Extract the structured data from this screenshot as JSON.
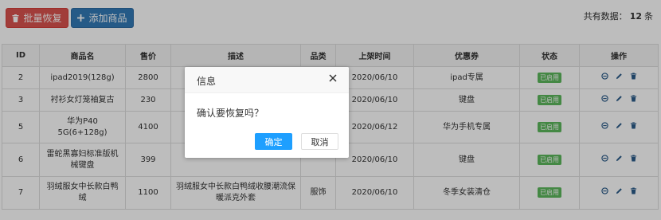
{
  "toolbar": {
    "batch_restore_label": "批量恢复",
    "add_product_label": "添加商品",
    "count_prefix": "共有数据：",
    "count_value": "12",
    "count_suffix": "条"
  },
  "table": {
    "headers": [
      "ID",
      "商品名",
      "售价",
      "描述",
      "品类",
      "上架时间",
      "优惠券",
      "状态",
      "操作"
    ],
    "rows": [
      {
        "id": "2",
        "name": "ipad2019(128g)",
        "price": "2800",
        "desc": "",
        "category": "",
        "date": "2020/06/10",
        "coupon": "ipad专属",
        "status": "已启用"
      },
      {
        "id": "3",
        "name": "衬衫女灯笼袖复古",
        "price": "230",
        "desc": "",
        "category": "",
        "date": "2020/06/10",
        "coupon": "键盘",
        "status": "已启用"
      },
      {
        "id": "5",
        "name": "华为P40 5G(6+128g)",
        "price": "4100",
        "desc": "",
        "category": "",
        "date": "2020/06/12",
        "coupon": "华为手机专属",
        "status": "已启用"
      },
      {
        "id": "6",
        "name": "雷蛇黑寡妇标准版机械键盘",
        "price": "399",
        "desc": "",
        "category": "",
        "date": "2020/06/10",
        "coupon": "键盘",
        "status": "已启用"
      },
      {
        "id": "7",
        "name": "羽绒服女中长款白鸭绒",
        "price": "1100",
        "desc": "羽绒服女中长款白鸭绒收腰潮流保暖派克外套",
        "category": "服饰",
        "date": "2020/06/10",
        "coupon": "冬季女装清仓",
        "status": "已启用"
      }
    ]
  },
  "dialog": {
    "title": "信息",
    "message": "确认要恢复吗？",
    "confirm_label": "确定",
    "cancel_label": "取消"
  },
  "colors": {
    "danger": "#d9534f",
    "primary": "#337ab7",
    "success": "#5cb85c",
    "dialog_ok": "#1e9fff"
  },
  "icons": {
    "batch_restore": "trash-icon",
    "add_product": "plus-icon",
    "row_actions": [
      "disable-icon",
      "edit-icon",
      "delete-icon"
    ],
    "dialog_close": "close-icon"
  }
}
